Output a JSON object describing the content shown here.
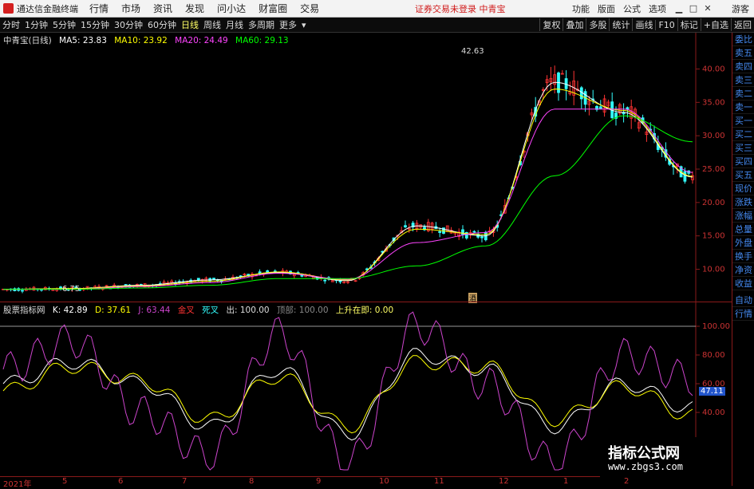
{
  "app": {
    "title": "通达信金融终端",
    "menu": [
      "行情",
      "市场",
      "资讯",
      "发现",
      "问小达",
      "财富圈",
      "交易"
    ],
    "notice": "证券交易未登录  中青宝",
    "right_menu": [
      "功能",
      "版面",
      "公式",
      "选项"
    ],
    "guest": "游客"
  },
  "periods": {
    "items": [
      "分时",
      "1分钟",
      "5分钟",
      "15分钟",
      "30分钟",
      "60分钟",
      "日线",
      "周线",
      "月线",
      "多周期",
      "更多"
    ],
    "active": "日线"
  },
  "tools": [
    "复权",
    "叠加",
    "多股",
    "统计",
    "画线",
    "F10",
    "标记",
    "+自选",
    "返回"
  ],
  "main_legend": {
    "name": "中青宝(日线)",
    "ma5": "MA5: 23.83",
    "ma10": "MA10: 23.92",
    "ma20": "MA20: 24.49",
    "ma60": "MA60: 29.13"
  },
  "ind_legend": {
    "name": "股票指标网",
    "k": "K: 42.89",
    "d": "D: 37.61",
    "j": "J: 63.44",
    "golden": "金叉",
    "dead": "死叉",
    "out": "出: 100.00",
    "top": "顶部: 100.00",
    "rise": "上升在即: 0.00"
  },
  "right_panel": {
    "quote": [
      "委比",
      "卖五",
      "卖四",
      "卖三",
      "卖二",
      "卖一",
      "买一",
      "买二",
      "买三",
      "买四",
      "买五",
      "现价",
      "涨跌",
      "涨幅",
      "总量",
      "外盘",
      "换手",
      "净资",
      "收益"
    ],
    "extra": [
      "自动",
      "行情"
    ]
  },
  "price_labels": {
    "high": "42.63",
    "low": "6.75",
    "marker": "酒"
  },
  "ind_current": "47.11",
  "xaxis": [
    "2021年",
    "5",
    "6",
    "7",
    "8",
    "9",
    "10",
    "11",
    "12",
    "1",
    "2"
  ],
  "watermark": {
    "line1": "指标公式网",
    "line2": "www.zbgs3.com"
  },
  "colors": {
    "up": "#ff3333",
    "down": "#33ffff",
    "ma5": "#ffffff",
    "ma10": "#ffff00",
    "ma20": "#ff44ff",
    "ma60": "#00ff00",
    "k": "#ffffff",
    "d": "#ffff00",
    "j": "#cc44cc"
  },
  "chart_data": [
    {
      "type": "line",
      "title": "中青宝(日线)",
      "x": [
        "2021年",
        "5",
        "6",
        "7",
        "8",
        "9",
        "10",
        "11",
        "12",
        "1",
        "2"
      ],
      "series": [
        {
          "name": "MA5",
          "values": [
            7.0,
            7.1,
            7.6,
            8.4,
            9.5,
            8.3,
            16.5,
            15.0,
            38.0,
            33.5,
            23.8
          ]
        },
        {
          "name": "MA10",
          "values": [
            7.0,
            7.1,
            7.5,
            8.2,
            9.6,
            8.4,
            16.0,
            15.2,
            37.0,
            33.8,
            23.9
          ]
        },
        {
          "name": "MA20",
          "values": [
            7.0,
            7.0,
            7.4,
            8.0,
            9.4,
            8.5,
            14.0,
            15.5,
            34.0,
            34.0,
            24.5
          ]
        },
        {
          "name": "MA60",
          "values": [
            7.0,
            7.0,
            7.2,
            7.6,
            8.6,
            8.6,
            10.5,
            13.5,
            24.0,
            33.0,
            29.1
          ]
        }
      ],
      "ylim": [
        6,
        44
      ],
      "yticks": [
        10,
        15,
        20,
        25,
        30,
        35,
        40
      ]
    },
    {
      "type": "line",
      "title": "股票指标网",
      "x": [
        "2021年",
        "5",
        "6",
        "7",
        "8",
        "9",
        "10",
        "11",
        "12",
        "1",
        "2"
      ],
      "series": [
        {
          "name": "K",
          "values": [
            60,
            75,
            60,
            30,
            70,
            25,
            80,
            70,
            30,
            60,
            42.89
          ]
        },
        {
          "name": "D",
          "values": [
            55,
            72,
            62,
            35,
            65,
            30,
            75,
            72,
            35,
            58,
            37.61
          ]
        },
        {
          "name": "J",
          "values": [
            70,
            90,
            40,
            10,
            95,
            5,
            100,
            60,
            5,
            80,
            63.44
          ]
        }
      ],
      "ylim": [
        0,
        110
      ],
      "yticks": [
        20,
        40,
        60,
        80,
        100
      ]
    }
  ]
}
